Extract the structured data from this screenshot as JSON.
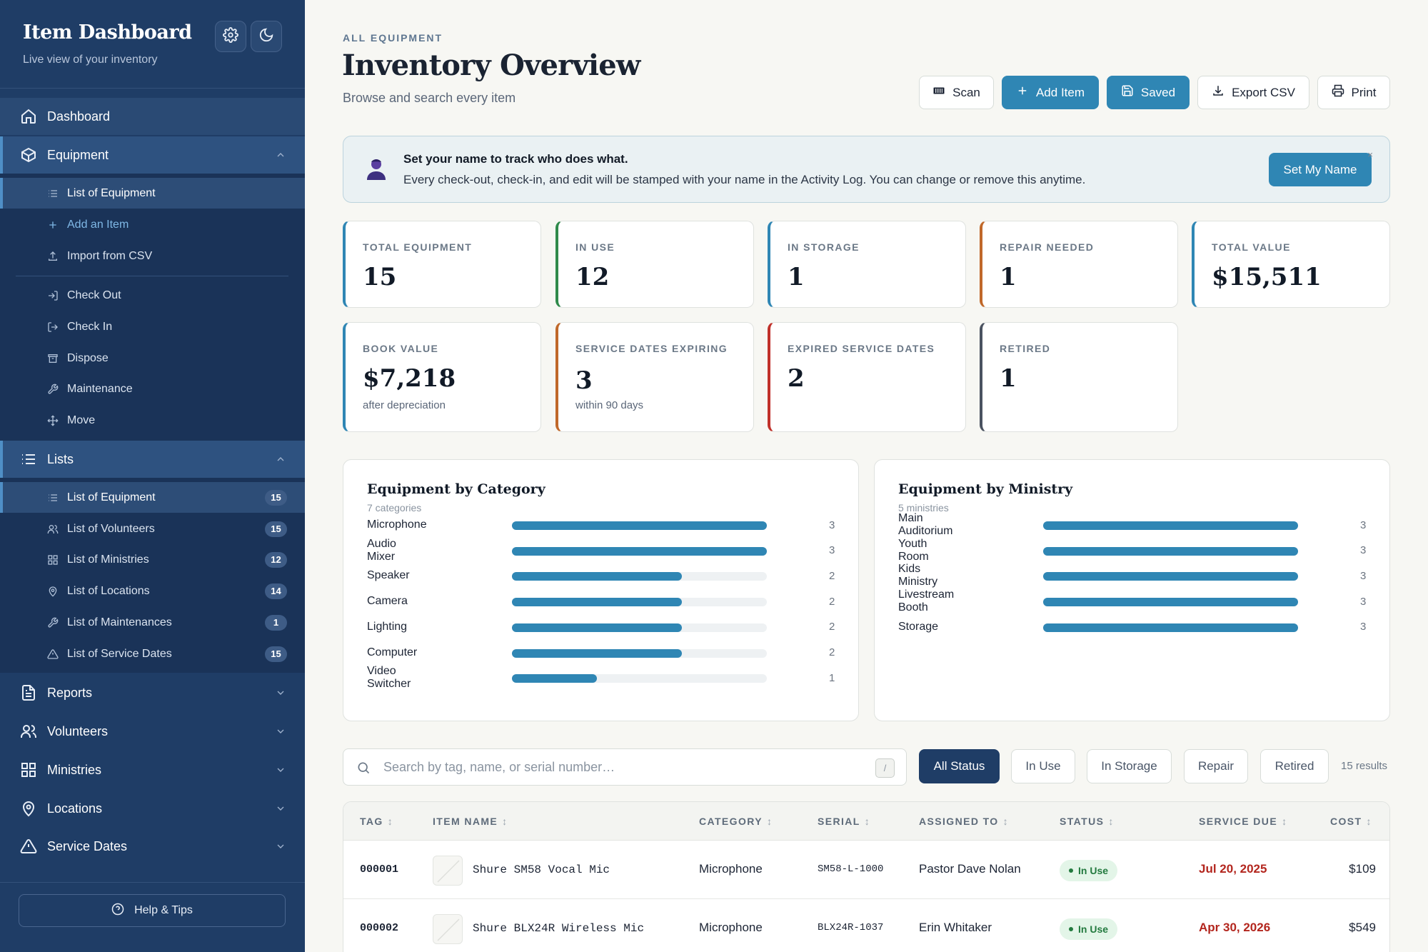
{
  "brand": {
    "title": "Item Dashboard",
    "subtitle": "Live view of your inventory",
    "settings_icon": "gear-icon",
    "theme_icon": "moon-icon"
  },
  "nav": {
    "dashboard": "Dashboard",
    "equipment": {
      "label": "Equipment",
      "items": [
        {
          "label": "List of Equipment"
        },
        {
          "label": "Add an Item"
        },
        {
          "label": "Import from CSV"
        },
        {
          "label": "Check Out"
        },
        {
          "label": "Check In"
        },
        {
          "label": "Dispose"
        },
        {
          "label": "Maintenance"
        },
        {
          "label": "Move"
        }
      ]
    },
    "lists": {
      "label": "Lists",
      "items": [
        {
          "label": "List of Equipment",
          "count": "15"
        },
        {
          "label": "List of Volunteers",
          "count": "15"
        },
        {
          "label": "List of Ministries",
          "count": "12"
        },
        {
          "label": "List of Locations",
          "count": "14"
        },
        {
          "label": "List of Maintenances",
          "count": "1"
        },
        {
          "label": "List of Service Dates",
          "count": "15"
        }
      ]
    },
    "reports": "Reports",
    "volunteers": "Volunteers",
    "ministries": "Ministries",
    "locations": "Locations",
    "service_dates": "Service Dates",
    "help": "Help & Tips"
  },
  "header": {
    "eyebrow": "ALL EQUIPMENT",
    "title": "Inventory Overview",
    "subtitle": "Browse and search every item"
  },
  "toolbar": {
    "scan": "Scan",
    "add": "Add Item",
    "saved": "Saved",
    "export": "Export CSV",
    "print": "Print"
  },
  "banner": {
    "title": "Set your name to track who does what.",
    "text": "Every check-out, check-in, and edit will be stamped with your name in the Activity Log. You can change or remove this anytime.",
    "button": "Set My Name",
    "close": "×"
  },
  "stats": [
    {
      "label": "TOTAL EQUIPMENT",
      "value": "15",
      "sub": "",
      "color": "#2f86b4"
    },
    {
      "label": "IN USE",
      "value": "12",
      "sub": "",
      "color": "#2f8a4b"
    },
    {
      "label": "IN STORAGE",
      "value": "1",
      "sub": "",
      "color": "#2f86b4"
    },
    {
      "label": "REPAIR NEEDED",
      "value": "1",
      "sub": "",
      "color": "#c0682a"
    },
    {
      "label": "TOTAL VALUE",
      "value": "$15,511",
      "sub": "",
      "color": "#2f86b4"
    },
    {
      "label": "BOOK VALUE",
      "value": "$7,218",
      "sub": "after depreciation",
      "color": "#2f86b4"
    },
    {
      "label": "SERVICE DATES EXPIRING",
      "value": "3",
      "sub": "within 90 days",
      "color": "#c0682a"
    },
    {
      "label": "EXPIRED SERVICE DATES",
      "value": "2",
      "sub": "",
      "color": "#c0302a"
    },
    {
      "label": "RETIRED",
      "value": "1",
      "sub": "",
      "color": "#4a5260"
    }
  ],
  "category_panel": {
    "title": "Equipment by Category",
    "subtitle": "7 categories",
    "max": 3,
    "rows": [
      {
        "label": "Microphone",
        "value": 3
      },
      {
        "label": "Audio Mixer",
        "value": 3
      },
      {
        "label": "Speaker",
        "value": 2
      },
      {
        "label": "Camera",
        "value": 2
      },
      {
        "label": "Lighting",
        "value": 2
      },
      {
        "label": "Computer",
        "value": 2
      },
      {
        "label": "Video Switcher",
        "value": 1
      }
    ]
  },
  "ministry_panel": {
    "title": "Equipment by Ministry",
    "subtitle": "5 ministries",
    "max": 3,
    "rows": [
      {
        "label": "Main Auditorium",
        "value": 3
      },
      {
        "label": "Youth Room",
        "value": 3
      },
      {
        "label": "Kids Ministry",
        "value": 3
      },
      {
        "label": "Livestream Booth",
        "value": 3
      },
      {
        "label": "Storage",
        "value": 3
      }
    ]
  },
  "search": {
    "placeholder": "Search by tag, name, or serial number…",
    "shortcut": "/"
  },
  "filters": [
    "All Status",
    "In Use",
    "In Storage",
    "Repair",
    "Retired"
  ],
  "results": "15 results",
  "table": {
    "columns": [
      "TAG",
      "ITEM NAME",
      "CATEGORY",
      "SERIAL",
      "ASSIGNED TO",
      "STATUS",
      "SERVICE DUE",
      "COST"
    ],
    "sort_glyph": "↕",
    "rows": [
      {
        "tag": "000001",
        "name": "Shure SM58 Vocal Mic",
        "category": "Microphone",
        "serial": "SM58-L-1000",
        "assigned": "Pastor Dave Nolan",
        "status": "In Use",
        "due": "Jul 20, 2025",
        "cost": "$109"
      },
      {
        "tag": "000002",
        "name": "Shure BLX24R Wireless Mic",
        "category": "Microphone",
        "serial": "BLX24R-1037",
        "assigned": "Erin Whitaker",
        "status": "In Use",
        "due": "Apr 30, 2026",
        "cost": "$549"
      }
    ]
  }
}
